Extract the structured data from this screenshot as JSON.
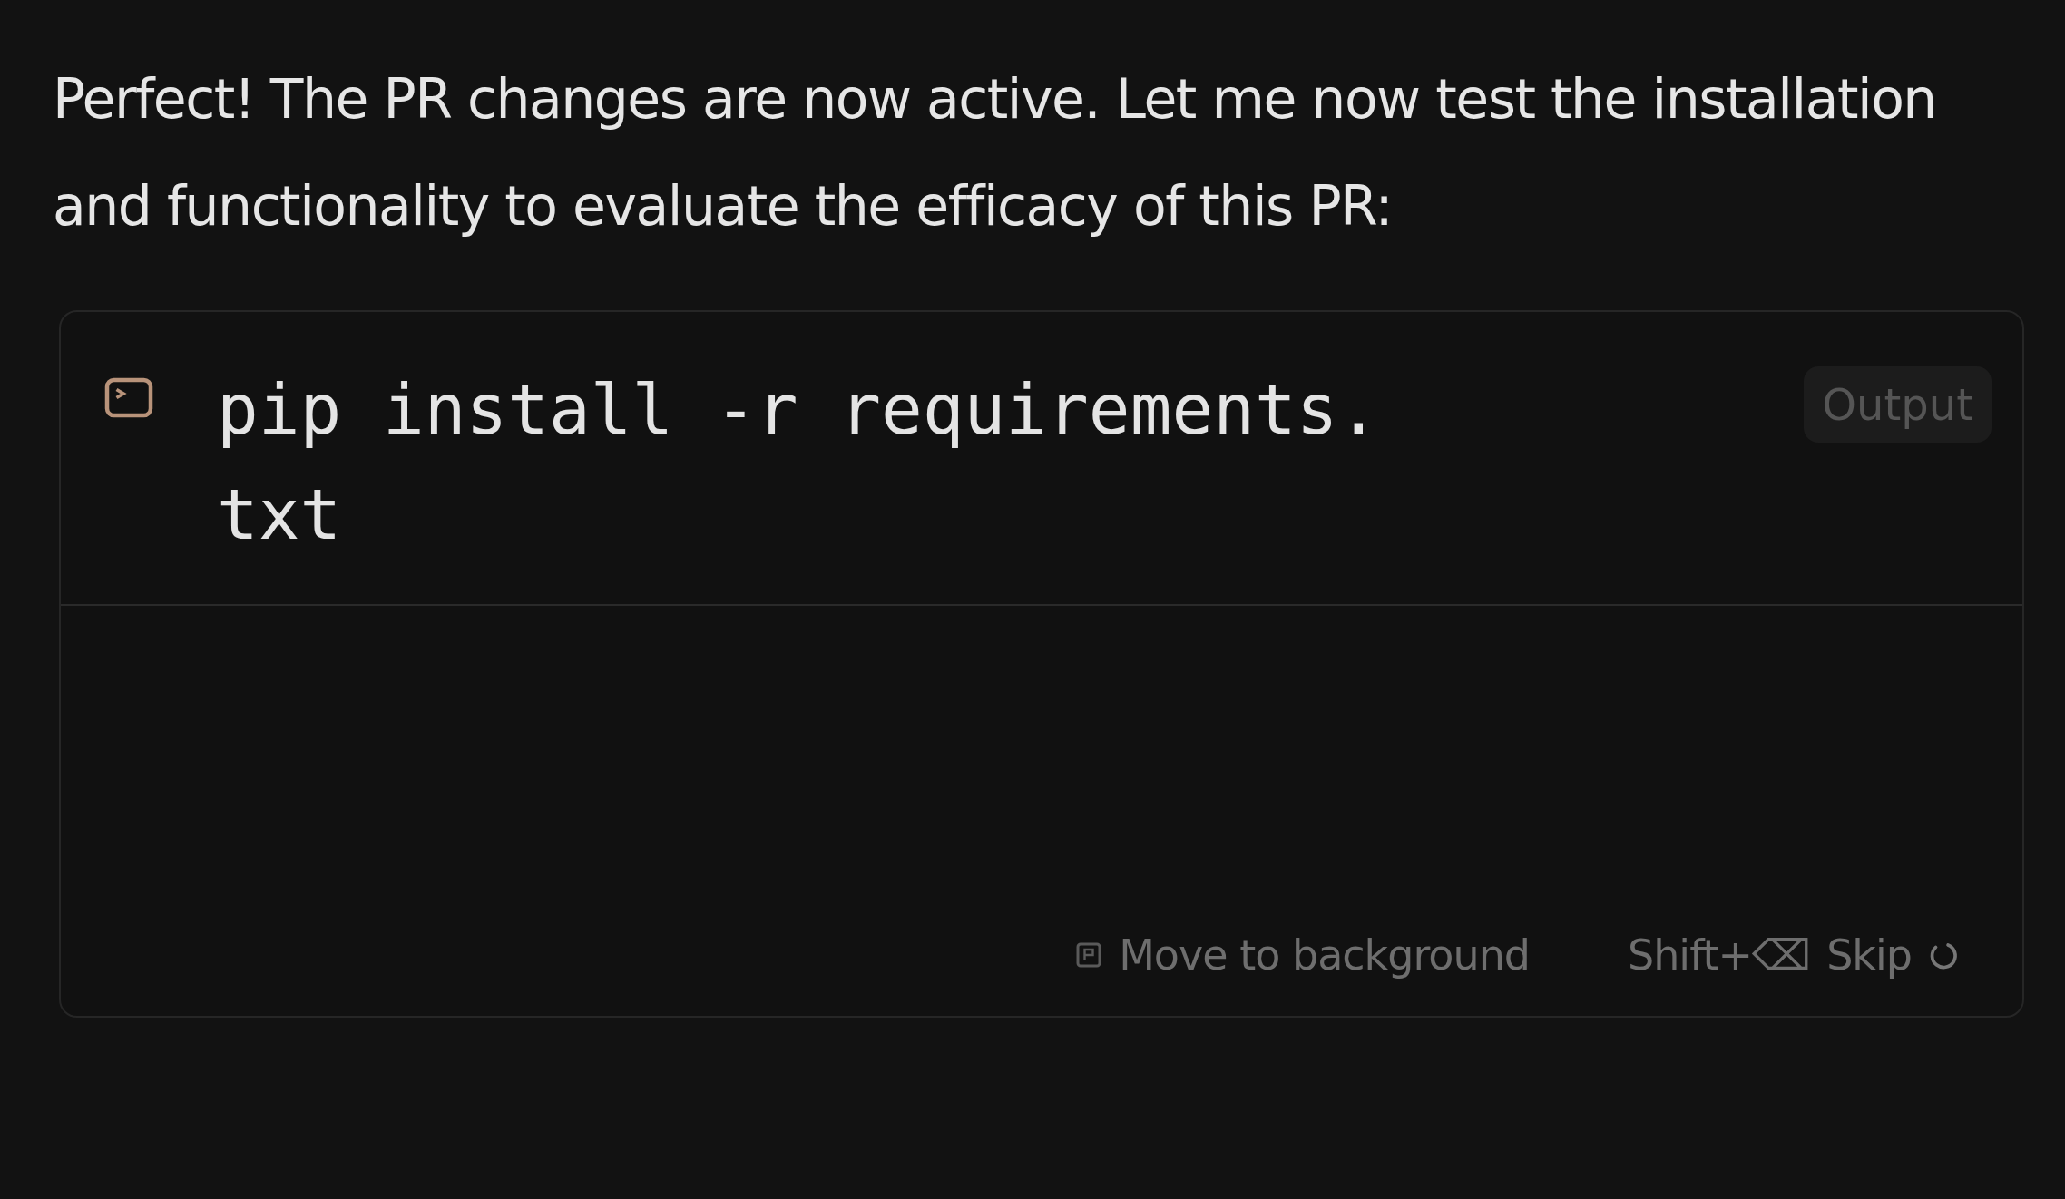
{
  "message": "Perfect! The PR changes are now active. Let me now test the installation and functionality to evaluate the efficacy of this PR:",
  "terminal": {
    "command": "pip install -r requirements.txt",
    "output_button": "Output",
    "footer": {
      "background_label": "Move to background",
      "shortcut": "Shift+⌫",
      "skip_label": "Skip"
    }
  }
}
